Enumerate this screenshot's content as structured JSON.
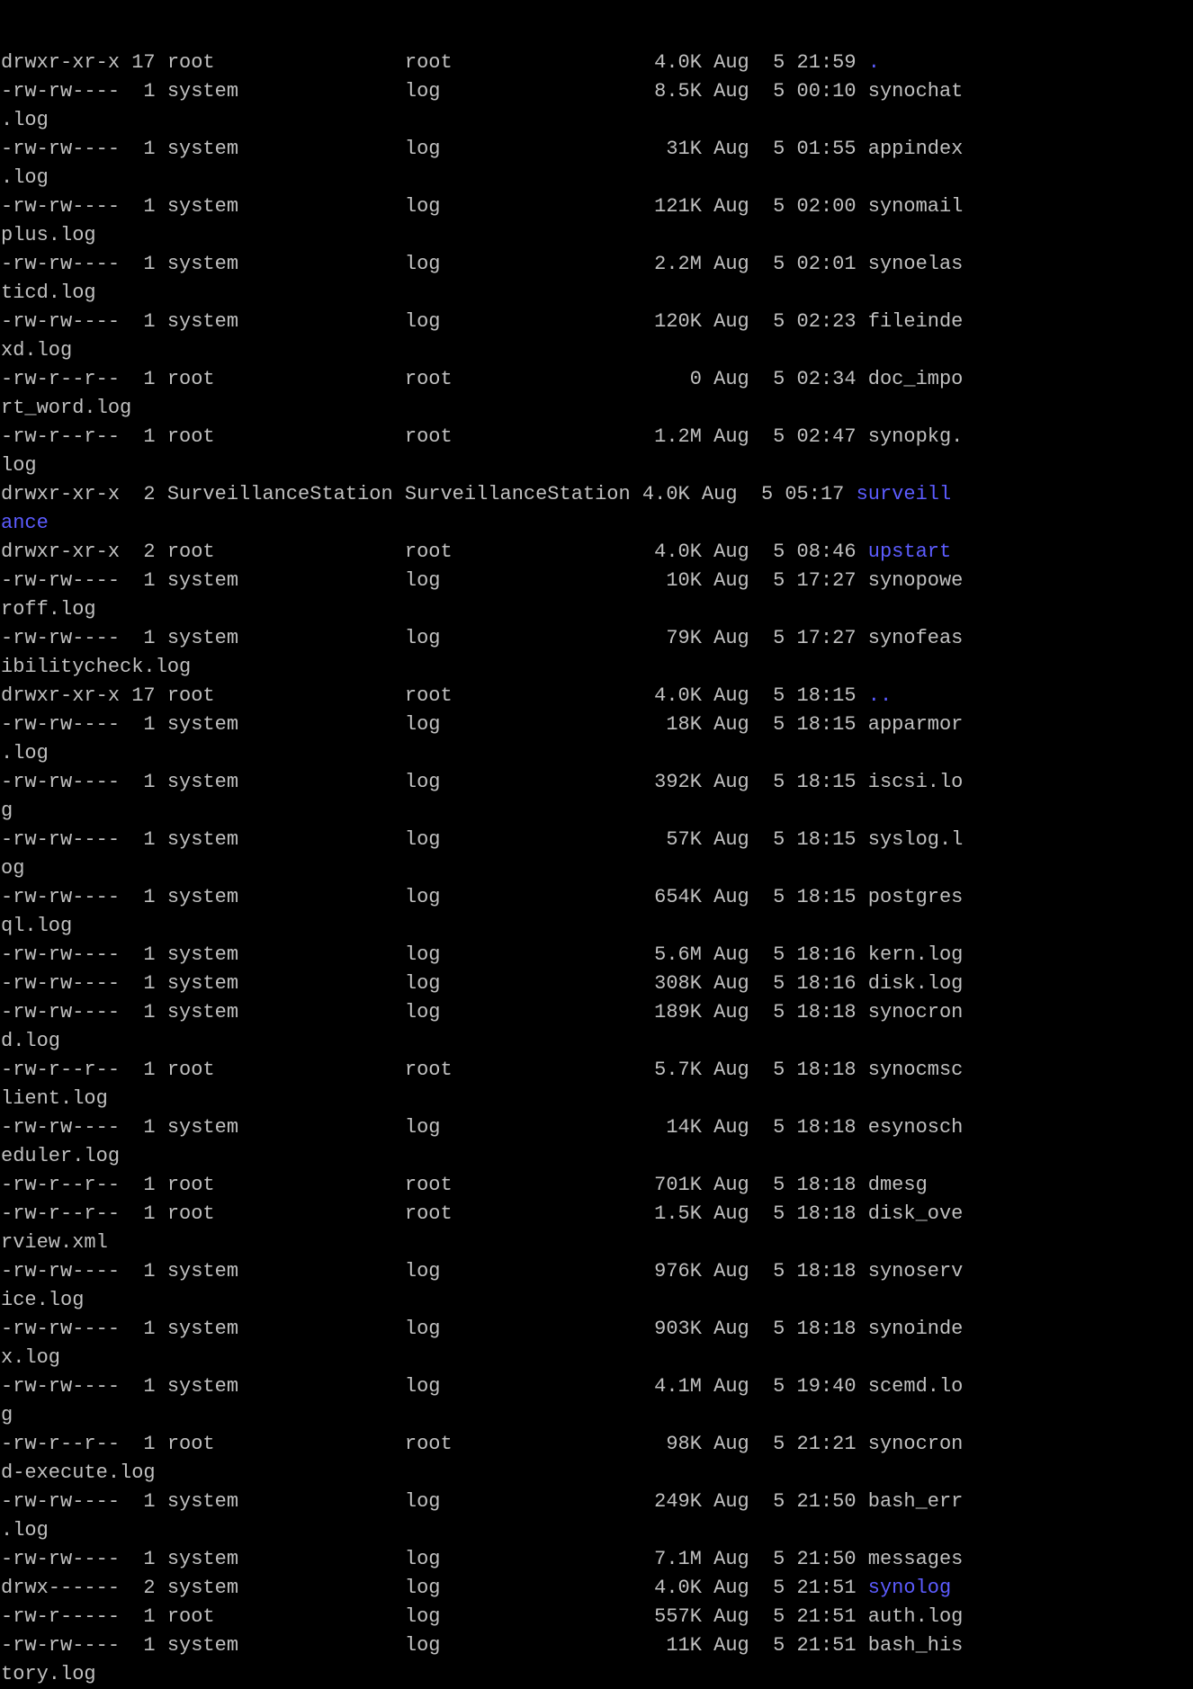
{
  "terminal": {
    "colors": {
      "background": "#000000",
      "foreground": "#c0c0c0",
      "directory": "#5c5cff"
    },
    "lines": [
      {
        "text": "drwxr-xr-x 17 root                root                 4.0K Aug  5 21:59 ",
        "dir": "."
      },
      {
        "text": "-rw-rw----  1 system              log                  8.5K Aug  5 00:10 synochat",
        "dir": ""
      },
      {
        "text": ".log",
        "dir": ""
      },
      {
        "text": "-rw-rw----  1 system              log                   31K Aug  5 01:55 appindex",
        "dir": ""
      },
      {
        "text": ".log",
        "dir": ""
      },
      {
        "text": "-rw-rw----  1 system              log                  121K Aug  5 02:00 synomail",
        "dir": ""
      },
      {
        "text": "plus.log",
        "dir": ""
      },
      {
        "text": "-rw-rw----  1 system              log                  2.2M Aug  5 02:01 synoelas",
        "dir": ""
      },
      {
        "text": "ticd.log",
        "dir": ""
      },
      {
        "text": "-rw-rw----  1 system              log                  120K Aug  5 02:23 fileinde",
        "dir": ""
      },
      {
        "text": "xd.log",
        "dir": ""
      },
      {
        "text": "-rw-r--r--  1 root                root                    0 Aug  5 02:34 doc_impo",
        "dir": ""
      },
      {
        "text": "rt_word.log",
        "dir": ""
      },
      {
        "text": "-rw-r--r--  1 root                root                 1.2M Aug  5 02:47 synopkg.",
        "dir": ""
      },
      {
        "text": "log",
        "dir": ""
      },
      {
        "text": "drwxr-xr-x  2 SurveillanceStation SurveillanceStation 4.0K Aug  5 05:17 ",
        "dir": "surveill"
      },
      {
        "text": "",
        "dir": "ance"
      },
      {
        "text": "drwxr-xr-x  2 root                root                 4.0K Aug  5 08:46 ",
        "dir": "upstart"
      },
      {
        "text": "-rw-rw----  1 system              log                   10K Aug  5 17:27 synopowe",
        "dir": ""
      },
      {
        "text": "roff.log",
        "dir": ""
      },
      {
        "text": "-rw-rw----  1 system              log                   79K Aug  5 17:27 synofeas",
        "dir": ""
      },
      {
        "text": "ibilitycheck.log",
        "dir": ""
      },
      {
        "text": "drwxr-xr-x 17 root                root                 4.0K Aug  5 18:15 ",
        "dir": ".."
      },
      {
        "text": "-rw-rw----  1 system              log                   18K Aug  5 18:15 apparmor",
        "dir": ""
      },
      {
        "text": ".log",
        "dir": ""
      },
      {
        "text": "-rw-rw----  1 system              log                  392K Aug  5 18:15 iscsi.lo",
        "dir": ""
      },
      {
        "text": "g",
        "dir": ""
      },
      {
        "text": "-rw-rw----  1 system              log                   57K Aug  5 18:15 syslog.l",
        "dir": ""
      },
      {
        "text": "og",
        "dir": ""
      },
      {
        "text": "-rw-rw----  1 system              log                  654K Aug  5 18:15 postgres",
        "dir": ""
      },
      {
        "text": "ql.log",
        "dir": ""
      },
      {
        "text": "-rw-rw----  1 system              log                  5.6M Aug  5 18:16 kern.log",
        "dir": ""
      },
      {
        "text": "-rw-rw----  1 system              log                  308K Aug  5 18:16 disk.log",
        "dir": ""
      },
      {
        "text": "-rw-rw----  1 system              log                  189K Aug  5 18:18 synocron",
        "dir": ""
      },
      {
        "text": "d.log",
        "dir": ""
      },
      {
        "text": "-rw-r--r--  1 root                root                 5.7K Aug  5 18:18 synocmsc",
        "dir": ""
      },
      {
        "text": "lient.log",
        "dir": ""
      },
      {
        "text": "-rw-rw----  1 system              log                   14K Aug  5 18:18 esynosch",
        "dir": ""
      },
      {
        "text": "eduler.log",
        "dir": ""
      },
      {
        "text": "-rw-r--r--  1 root                root                 701K Aug  5 18:18 dmesg",
        "dir": ""
      },
      {
        "text": "-rw-r--r--  1 root                root                 1.5K Aug  5 18:18 disk_ove",
        "dir": ""
      },
      {
        "text": "rview.xml",
        "dir": ""
      },
      {
        "text": "-rw-rw----  1 system              log                  976K Aug  5 18:18 synoserv",
        "dir": ""
      },
      {
        "text": "ice.log",
        "dir": ""
      },
      {
        "text": "-rw-rw----  1 system              log                  903K Aug  5 18:18 synoinde",
        "dir": ""
      },
      {
        "text": "x.log",
        "dir": ""
      },
      {
        "text": "-rw-rw----  1 system              log                  4.1M Aug  5 19:40 scemd.lo",
        "dir": ""
      },
      {
        "text": "g",
        "dir": ""
      },
      {
        "text": "-rw-r--r--  1 root                root                  98K Aug  5 21:21 synocron",
        "dir": ""
      },
      {
        "text": "d-execute.log",
        "dir": ""
      },
      {
        "text": "-rw-rw----  1 system              log                  249K Aug  5 21:50 bash_err",
        "dir": ""
      },
      {
        "text": ".log",
        "dir": ""
      },
      {
        "text": "-rw-rw----  1 system              log                  7.1M Aug  5 21:50 messages",
        "dir": ""
      },
      {
        "text": "drwx------  2 system              log                  4.0K Aug  5 21:51 ",
        "dir": "synolog"
      },
      {
        "text": "-rw-r-----  1 root                log                  557K Aug  5 21:51 auth.log",
        "dir": ""
      },
      {
        "text": "-rw-rw----  1 system              log                   11K Aug  5 21:51 bash_his",
        "dir": ""
      },
      {
        "text": "tory.log",
        "dir": ""
      }
    ]
  }
}
